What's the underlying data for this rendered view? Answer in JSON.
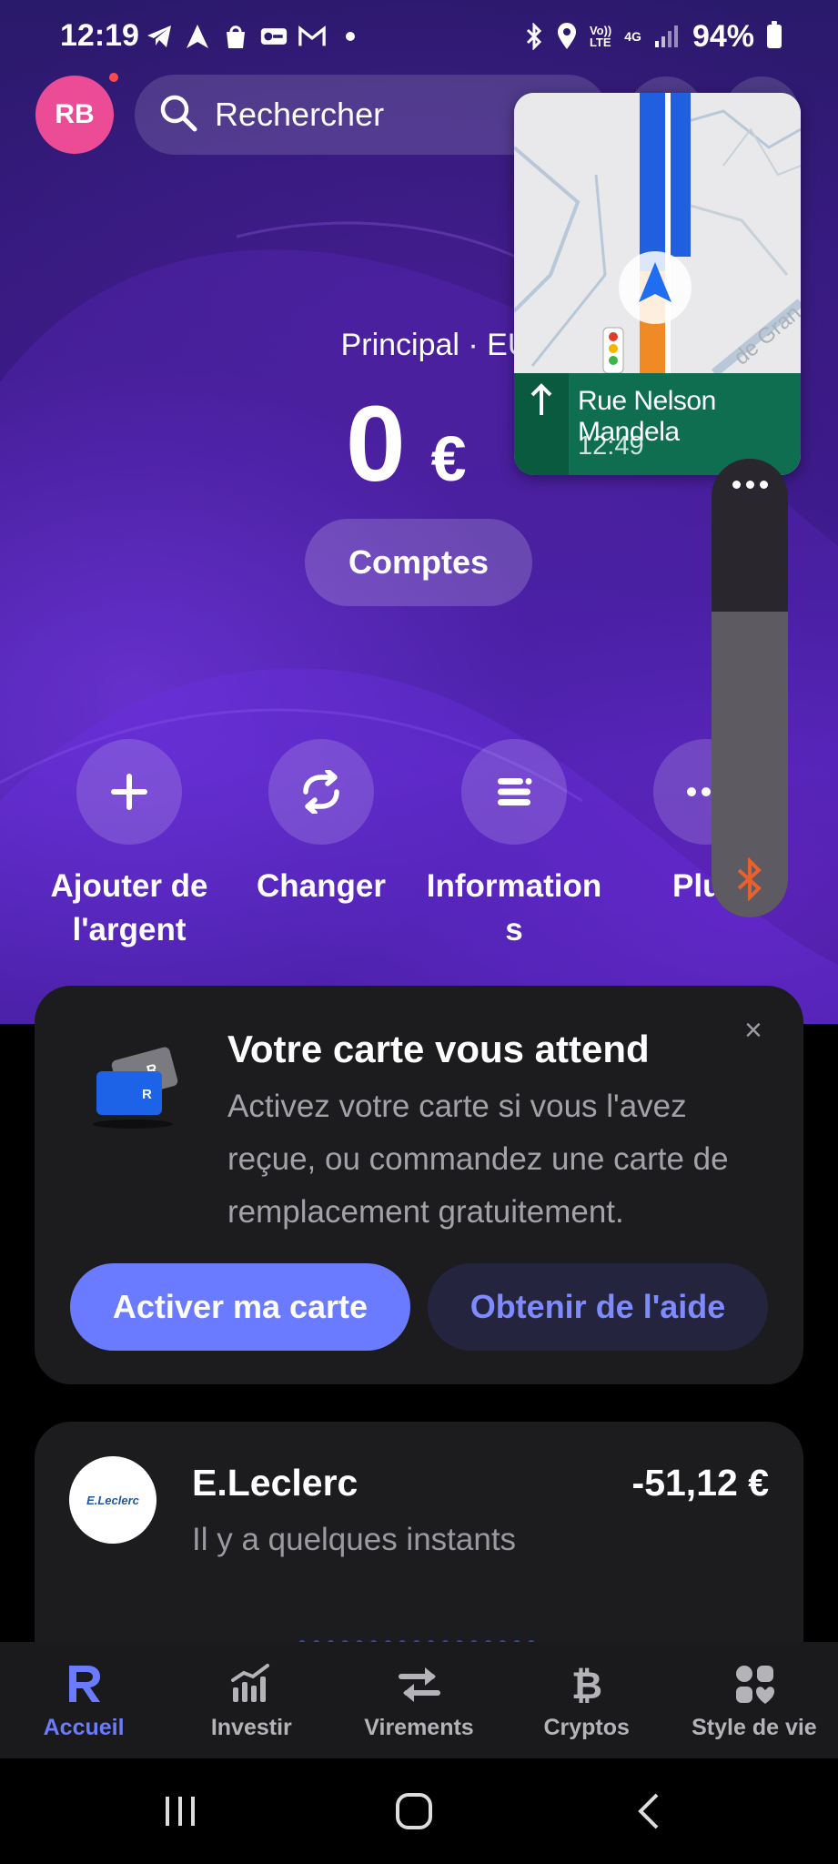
{
  "status_bar": {
    "time": "12:19",
    "battery": "94%",
    "network": "4G",
    "left_icons": [
      "telegram-icon",
      "navigation-icon",
      "shopping-bag-icon",
      "key-icon",
      "gmail-icon",
      "dot-icon"
    ],
    "right_icons": [
      "bluetooth-icon",
      "location-icon",
      "volte-icon",
      "data-4g-icon",
      "signal-icon",
      "battery-icon"
    ]
  },
  "header": {
    "avatar_initials": "RB",
    "search_placeholder": "Rechercher"
  },
  "balance": {
    "account_label": "Principal · EUR",
    "account_label_visible": "Principal · EU",
    "amount": "0",
    "currency": "€",
    "accounts_button": "Comptes"
  },
  "quick_actions": [
    {
      "label": "Ajouter de l'argent",
      "icon": "plus-icon"
    },
    {
      "label": "Changer",
      "icon": "exchange-icon"
    },
    {
      "label": "Informations",
      "icon": "details-icon"
    },
    {
      "label": "Plus",
      "icon": "more-icon"
    }
  ],
  "maps_pip": {
    "street": "Rue Nelson Mandela",
    "eta": "12:49",
    "map_road_label": "de Gran"
  },
  "card_notice": {
    "title": "Votre carte vous attend",
    "body": "Activez votre carte si vous l'avez reçue, ou commandez une carte de remplacement gratuitement.",
    "primary_button": "Activer ma carte",
    "secondary_button": "Obtenir de l'aide",
    "close": "×"
  },
  "transaction": {
    "merchant": "E.Leclerc",
    "time": "Il y a quelques instants",
    "amount": "-51,12 €",
    "logo_text": "E.Leclerc"
  },
  "bottom_nav": [
    {
      "label": "Accueil",
      "icon": "revolut-r-icon",
      "active": true
    },
    {
      "label": "Investir",
      "icon": "invest-chart-icon",
      "active": false
    },
    {
      "label": "Virements",
      "icon": "transfer-arrows-icon",
      "active": false
    },
    {
      "label": "Cryptos",
      "icon": "bitcoin-icon",
      "active": false
    },
    {
      "label": "Style de vie",
      "icon": "lifestyle-icon",
      "active": false
    }
  ],
  "colors": {
    "accent": "#6a7bff",
    "avatar": "#ec4c95",
    "card_bg": "#1c1c1e",
    "maps_green": "#0f6e4f"
  }
}
